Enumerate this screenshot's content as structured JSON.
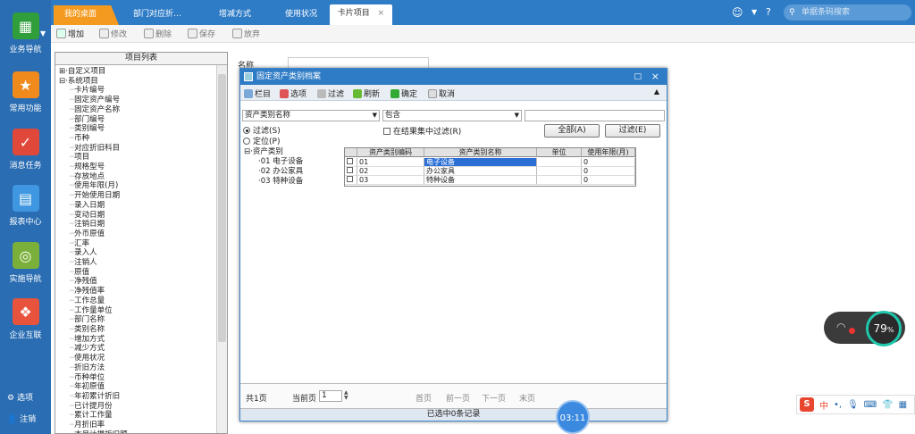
{
  "nav": {
    "items": [
      {
        "label": "业务导航",
        "icon": "business-nav-icon",
        "color": "#2f9e3b"
      },
      {
        "label": "常用功能",
        "icon": "star-icon",
        "color": "#f08a1c"
      },
      {
        "label": "消息任务",
        "icon": "message-task-icon",
        "color": "#e0483a"
      },
      {
        "label": "报表中心",
        "icon": "report-icon",
        "color": "#3e97e0"
      },
      {
        "label": "实施导航",
        "icon": "compass-icon",
        "color": "#7ab03a"
      },
      {
        "label": "企业互联",
        "icon": "enterprise-icon",
        "color": "#e8533d"
      }
    ],
    "bottom": [
      {
        "label": "选项",
        "icon": "gear-icon",
        "glyph": "⚙"
      },
      {
        "label": "注销",
        "icon": "user-icon",
        "glyph": "👤"
      }
    ]
  },
  "tabs": [
    {
      "label": "我的桌面",
      "type": "home"
    },
    {
      "label": "部门对应折…",
      "type": "normal"
    },
    {
      "label": "增减方式",
      "type": "normal"
    },
    {
      "label": "使用状况",
      "type": "normal"
    },
    {
      "label": "卡片项目",
      "type": "active",
      "close": "×"
    }
  ],
  "search": {
    "placeholder": "单据条码搜索"
  },
  "toolbar": [
    {
      "label": "增加",
      "enabled": true
    },
    {
      "label": "修改",
      "enabled": false
    },
    {
      "label": "删除",
      "enabled": false
    },
    {
      "label": "保存",
      "enabled": false
    },
    {
      "label": "放弃",
      "enabled": false
    }
  ],
  "tree_panel": {
    "title": "项目列表",
    "root_custom": "自定义项目",
    "root_system": "系统项目",
    "items": [
      "卡片编号",
      "固定资产编号",
      "固定资产名称",
      "部门编号",
      "类别编号",
      "币种",
      "对应折旧科目",
      "项目",
      "规格型号",
      "存放地点",
      "使用年限(月)",
      "开始使用日期",
      "录入日期",
      "变动日期",
      "注销日期",
      "外币原值",
      "汇率",
      "录入人",
      "注销人",
      "原值",
      "净残值",
      "净残值率",
      "工作总量",
      "工作量单位",
      "部门名称",
      "类别名称",
      "增加方式",
      "减少方式",
      "使用状况",
      "折旧方法",
      "币种单位",
      "年初原值",
      "年初累计折旧",
      "已计提月份",
      "累计工作量",
      "月折旧率",
      "本月计提折旧额"
    ]
  },
  "form": {
    "name_label": "名称"
  },
  "dialog": {
    "title": "固定资产类别档案",
    "buttons": [
      "栏目",
      "选项",
      "过滤",
      "刷新",
      "确定",
      "取消"
    ],
    "filter_field": "资产类别名称",
    "filter_op": "包含",
    "filter_value": "",
    "radio_filter": "过滤(S)",
    "radio_locate": "定位(P)",
    "check_in_result": "在结果集中过滤(R)",
    "btn_all": "全部(A)",
    "btn_filter": "过滤(E)",
    "tree_root": "资产类别",
    "tree_children": [
      "01 电子设备",
      "02 办公家具",
      "03 特种设备"
    ],
    "columns": [
      "资产类别编码",
      "资产类别名称",
      "单位",
      "使用年限(月)"
    ],
    "rows": [
      {
        "code": "01",
        "name": "电子设备",
        "unit": "",
        "years": "0"
      },
      {
        "code": "02",
        "name": "办公家具",
        "unit": "",
        "years": "0"
      },
      {
        "code": "03",
        "name": "特种设备",
        "unit": "",
        "years": "0"
      }
    ],
    "pager": {
      "total": "共1页",
      "current_label": "当前页",
      "current_value": "1",
      "first": "首页",
      "prev": "前一页",
      "next": "下一页",
      "last": "末页"
    },
    "status": "已选中0条记录"
  },
  "overlay": {
    "timer": "03:11",
    "battery_pct": "79",
    "battery_unit": "%"
  },
  "ime": {
    "logo": "S",
    "mode": "中"
  }
}
